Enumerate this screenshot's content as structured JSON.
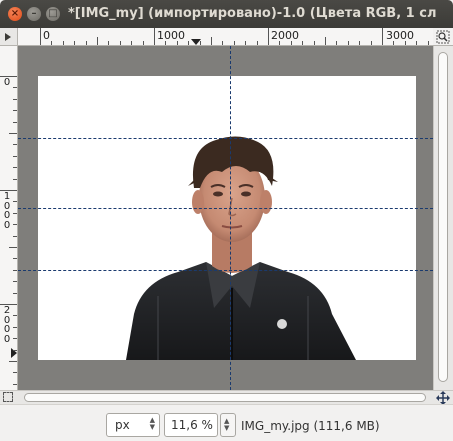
{
  "window": {
    "title": "*[IMG_my] (импортировано)-1.0 (Цвета RGB, 1 сл"
  },
  "rulers": {
    "horizontal_labels": [
      "0",
      "1000",
      "2000",
      "3000"
    ],
    "vertical_labels": [
      "0",
      "1000",
      "2000"
    ]
  },
  "statusbar": {
    "unit": "px",
    "zoom": "11,6 %",
    "file_info": "IMG_my.jpg (111,6 MB)"
  },
  "icons": [
    "close-icon",
    "minimize-icon",
    "maximize-icon",
    "ruler-menu-icon",
    "zoom-fit-icon",
    "quick-mask-icon",
    "navigate-icon"
  ],
  "colors": {
    "canvas_background": "#7f7e7b",
    "image_background": "#ffffff",
    "guide_color": "#1a3a6e",
    "titlebar": "#3c3b37"
  }
}
